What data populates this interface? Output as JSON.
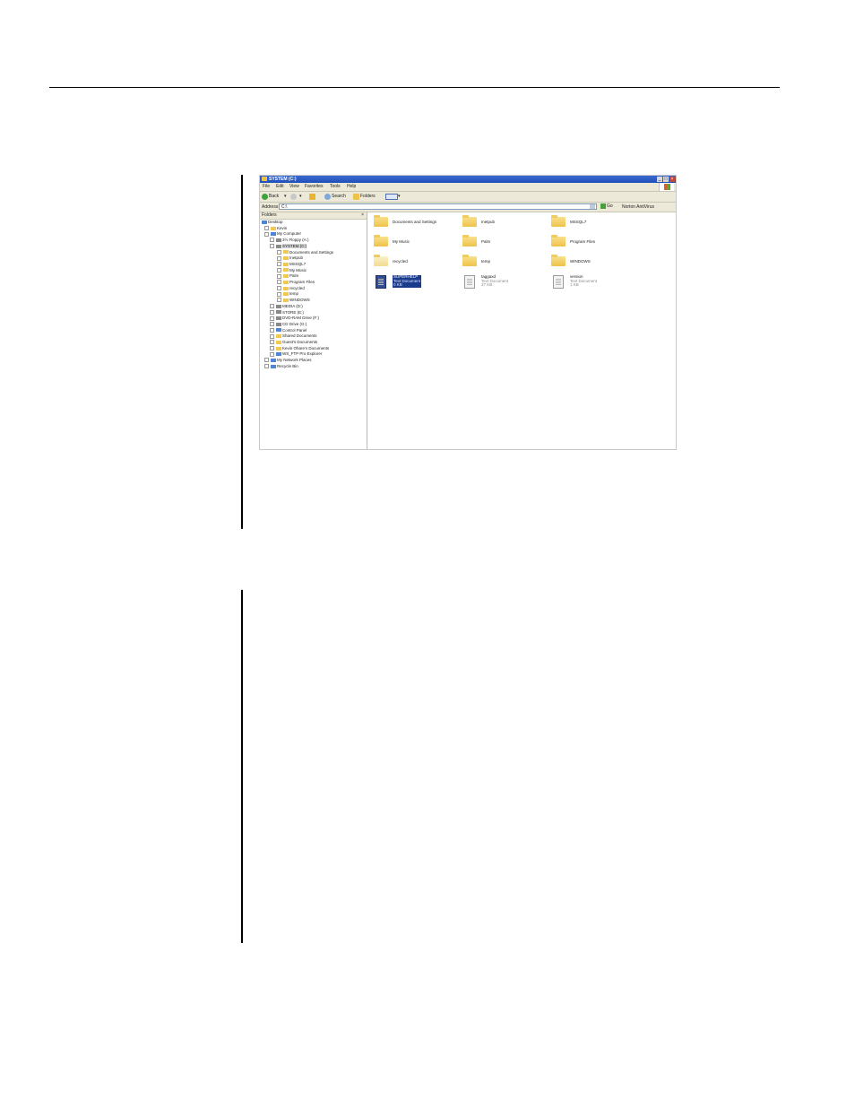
{
  "window": {
    "title": "SYSTEM (C:)",
    "controls": [
      "_",
      "□",
      "×"
    ]
  },
  "menu": [
    "File",
    "Edit",
    "View",
    "Favorites",
    "Tools",
    "Help"
  ],
  "toolbar": {
    "back": "Back",
    "search": "Search",
    "folders": "Folders"
  },
  "address": {
    "label": "Address",
    "value": "C:\\",
    "go": "Go",
    "norton": "Norton AntiVirus"
  },
  "folders_pane": {
    "title": "Folders",
    "close": "×",
    "tree": [
      {
        "label": "Desktop",
        "level": 0,
        "icon": "desktop-icon"
      },
      {
        "label": "Kevin",
        "level": 1,
        "icon": "folder-icon"
      },
      {
        "label": "My Computer",
        "level": 1,
        "icon": "computer-icon"
      },
      {
        "label": "3½ Floppy (A:)",
        "level": 2,
        "icon": "floppy-icon"
      },
      {
        "label": "SYSTEM (C:)",
        "level": 2,
        "icon": "drive-icon",
        "selected": true
      },
      {
        "label": "Documents and Settings",
        "level": 3,
        "icon": "folder-icon"
      },
      {
        "label": "Inetpub",
        "level": 3,
        "icon": "folder-icon"
      },
      {
        "label": "MSSQL7",
        "level": 3,
        "icon": "folder-icon"
      },
      {
        "label": "My Music",
        "level": 3,
        "icon": "folder-icon"
      },
      {
        "label": "Palm",
        "level": 3,
        "icon": "folder-icon"
      },
      {
        "label": "Program Files",
        "level": 3,
        "icon": "folder-icon"
      },
      {
        "label": "recycled",
        "level": 3,
        "icon": "folder-icon"
      },
      {
        "label": "temp",
        "level": 3,
        "icon": "folder-icon"
      },
      {
        "label": "WINDOWS",
        "level": 3,
        "icon": "folder-icon"
      },
      {
        "label": "MEDIA (D:)",
        "level": 2,
        "icon": "drive-icon"
      },
      {
        "label": "STORE (E:)",
        "level": 2,
        "icon": "drive-icon"
      },
      {
        "label": "DVD-RAM Drive (F:)",
        "level": 2,
        "icon": "dvd-icon"
      },
      {
        "label": "CD Drive (G:)",
        "level": 2,
        "icon": "cd-icon"
      },
      {
        "label": "Control Panel",
        "level": 2,
        "icon": "control-panel-icon"
      },
      {
        "label": "Shared Documents",
        "level": 2,
        "icon": "folder-icon"
      },
      {
        "label": "Guest's Documents",
        "level": 2,
        "icon": "folder-icon"
      },
      {
        "label": "Kevin Ohare's Documents",
        "level": 2,
        "icon": "folder-icon"
      },
      {
        "label": "WS_FTP Pro Explorer",
        "level": 2,
        "icon": "ftp-icon"
      },
      {
        "label": "My Network Places",
        "level": 1,
        "icon": "network-icon"
      },
      {
        "label": "Recycle Bin",
        "level": 1,
        "icon": "recycle-bin-icon"
      }
    ]
  },
  "content_items": [
    {
      "name": "Documents and Settings",
      "type": "folder"
    },
    {
      "name": "Inetpub",
      "type": "folder"
    },
    {
      "name": "MSSQL7",
      "type": "folder"
    },
    {
      "name": "My Music",
      "type": "folder"
    },
    {
      "name": "Palm",
      "type": "folder"
    },
    {
      "name": "Program Files",
      "type": "folder"
    },
    {
      "name": "recycled",
      "type": "folder",
      "pale": true
    },
    {
      "name": "temp",
      "type": "folder"
    },
    {
      "name": "WINDOWS",
      "type": "folder"
    },
    {
      "name": "SUPERHELP",
      "type": "file",
      "kind": "Text Document",
      "size": "0 KB",
      "selected": true
    },
    {
      "name": "taggaxd",
      "type": "file",
      "kind": "Text Document",
      "size": "37 KB"
    },
    {
      "name": "version",
      "type": "file",
      "kind": "Text Document",
      "size": "1 KB"
    }
  ],
  "colors": {
    "titlebar": "#1f4fb8",
    "chrome": "#ece9d8",
    "selection": "#1a3a8c",
    "folder": "#efc24a"
  }
}
